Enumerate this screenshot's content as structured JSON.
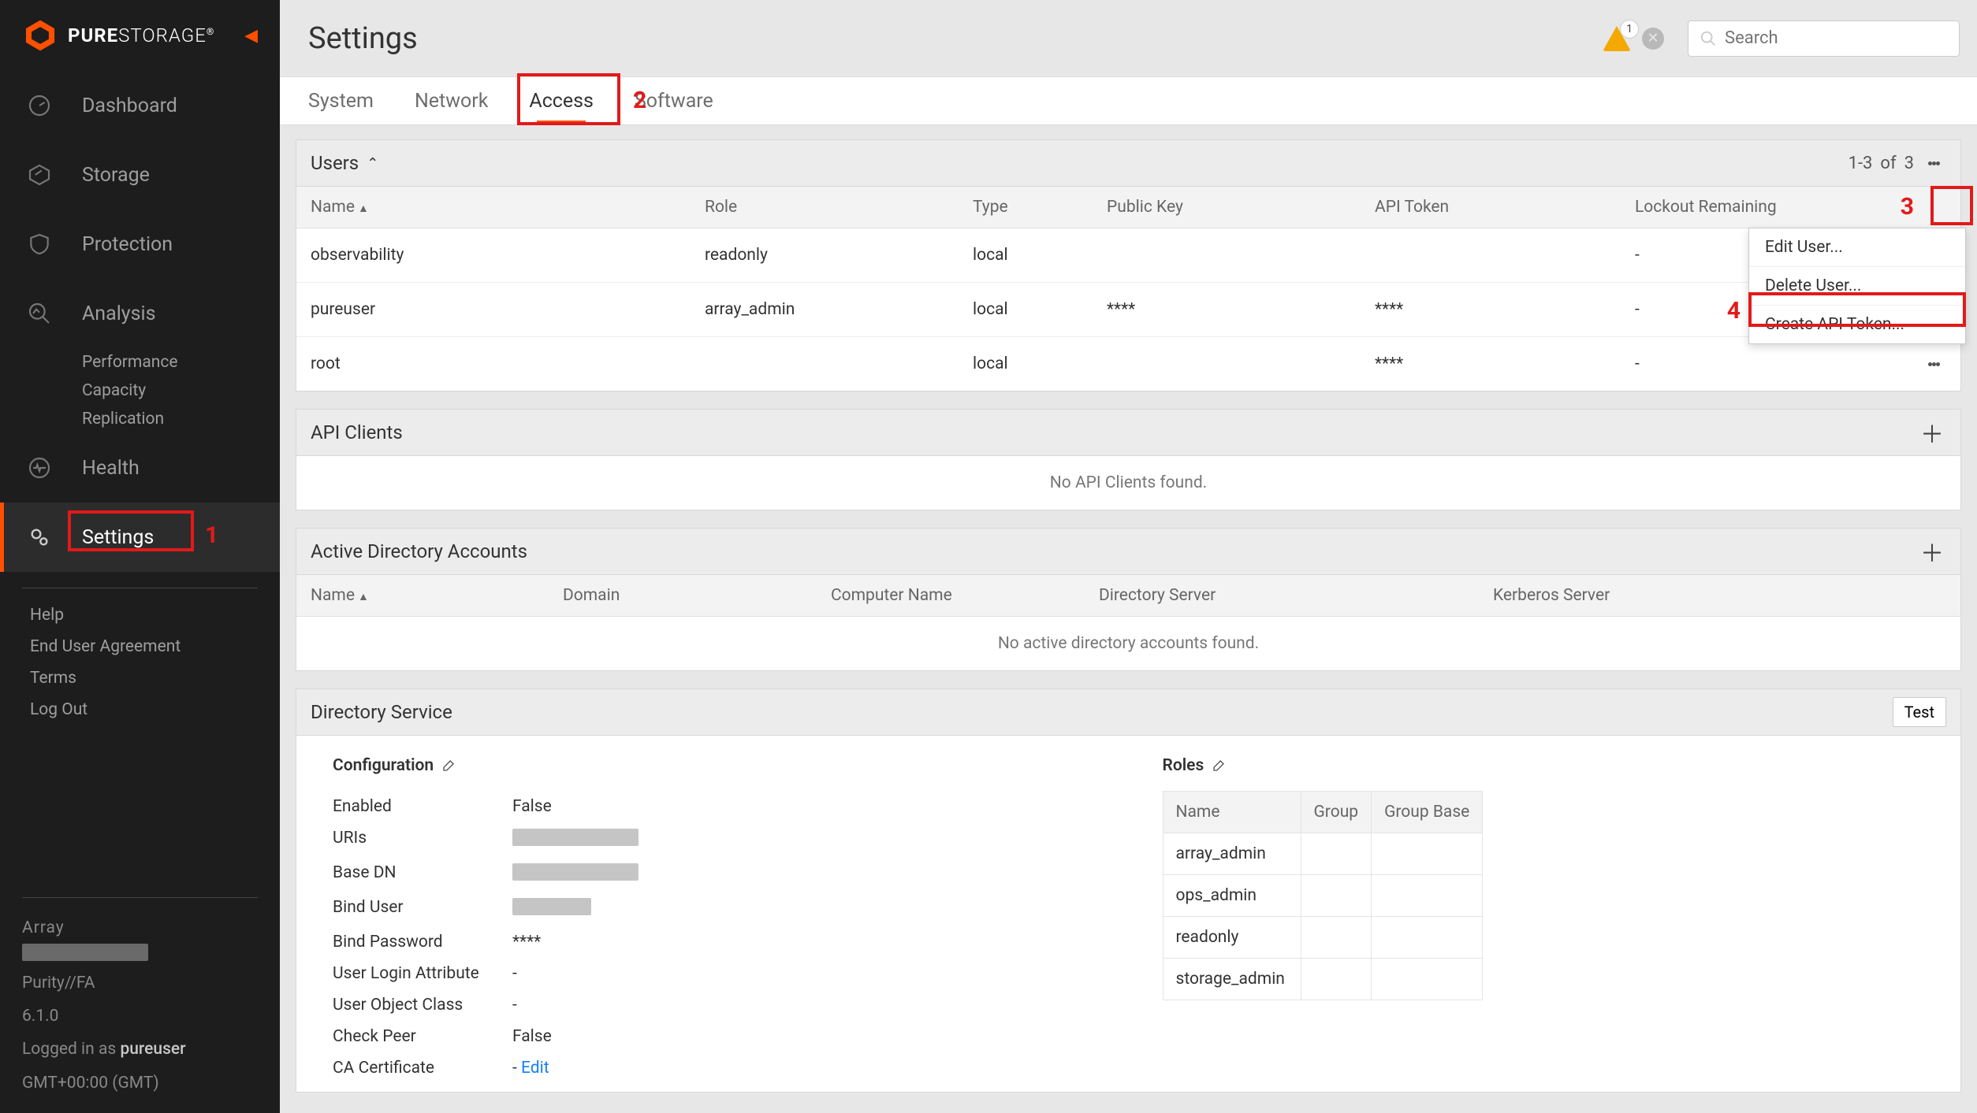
{
  "brand": {
    "prefix": "PURE",
    "suffix": "STORAGE",
    "reg": "®"
  },
  "nav": {
    "items": [
      {
        "label": "Dashboard"
      },
      {
        "label": "Storage"
      },
      {
        "label": "Protection"
      },
      {
        "label": "Analysis",
        "children": [
          "Performance",
          "Capacity",
          "Replication"
        ]
      },
      {
        "label": "Health"
      },
      {
        "label": "Settings",
        "selected": true
      }
    ],
    "links": [
      "Help",
      "End User Agreement",
      "Terms",
      "Log Out"
    ],
    "array": {
      "heading": "Array",
      "product": "Purity//FA",
      "version": "6.1.0",
      "login_prefix": "Logged in as ",
      "login_user": "pureuser",
      "tz": "GMT+00:00 (GMT)"
    }
  },
  "page": {
    "title": "Settings"
  },
  "header": {
    "alert_count": "1",
    "search_placeholder": "Search"
  },
  "tabs": [
    "System",
    "Network",
    "Access",
    "Software"
  ],
  "active_tab": "Access",
  "users_panel": {
    "title": "Users",
    "pager": {
      "range": "1-3",
      "of_word": "of",
      "total": "3"
    },
    "columns": [
      "Name",
      "Role",
      "Type",
      "Public Key",
      "API Token",
      "Lockout Remaining"
    ],
    "rows": [
      {
        "name": "observability",
        "role": "readonly",
        "type": "local",
        "pk": "",
        "token": "",
        "lockout": "-"
      },
      {
        "name": "pureuser",
        "role": "array_admin",
        "type": "local",
        "pk": "****",
        "token": "****",
        "lockout": "-"
      },
      {
        "name": "root",
        "role": "",
        "type": "local",
        "pk": "",
        "token": "****",
        "lockout": "-"
      }
    ]
  },
  "ctx": {
    "items": [
      "Edit User...",
      "Delete User...",
      "Create API Token..."
    ]
  },
  "api_clients_panel": {
    "title": "API Clients",
    "empty": "No API Clients found."
  },
  "ad_panel": {
    "title": "Active Directory Accounts",
    "columns": [
      "Name",
      "Domain",
      "Computer Name",
      "Directory Server",
      "Kerberos Server"
    ],
    "empty": "No active directory accounts found."
  },
  "ds_panel": {
    "title": "Directory Service",
    "test_label": "Test",
    "config_title": "Configuration",
    "roles_title": "Roles",
    "config_rows": [
      {
        "k": "Enabled",
        "v": "False"
      },
      {
        "k": "URIs",
        "v": "",
        "masked": true
      },
      {
        "k": "Base DN",
        "v": "",
        "masked": true
      },
      {
        "k": "Bind User",
        "v": "",
        "masked": true
      },
      {
        "k": "Bind Password",
        "v": "****"
      },
      {
        "k": "User Login Attribute",
        "v": "-"
      },
      {
        "k": "User Object Class",
        "v": "-"
      },
      {
        "k": "Check Peer",
        "v": "False"
      },
      {
        "k": "CA Certificate",
        "v": "Edit",
        "link": true,
        "dash": "- "
      }
    ],
    "roles_columns": [
      "Name",
      "Group",
      "Group Base"
    ],
    "roles_rows": [
      "array_admin",
      "ops_admin",
      "readonly",
      "storage_admin"
    ]
  },
  "annotations": {
    "n1": "1",
    "n2": "2",
    "n3": "3",
    "n4": "4"
  }
}
